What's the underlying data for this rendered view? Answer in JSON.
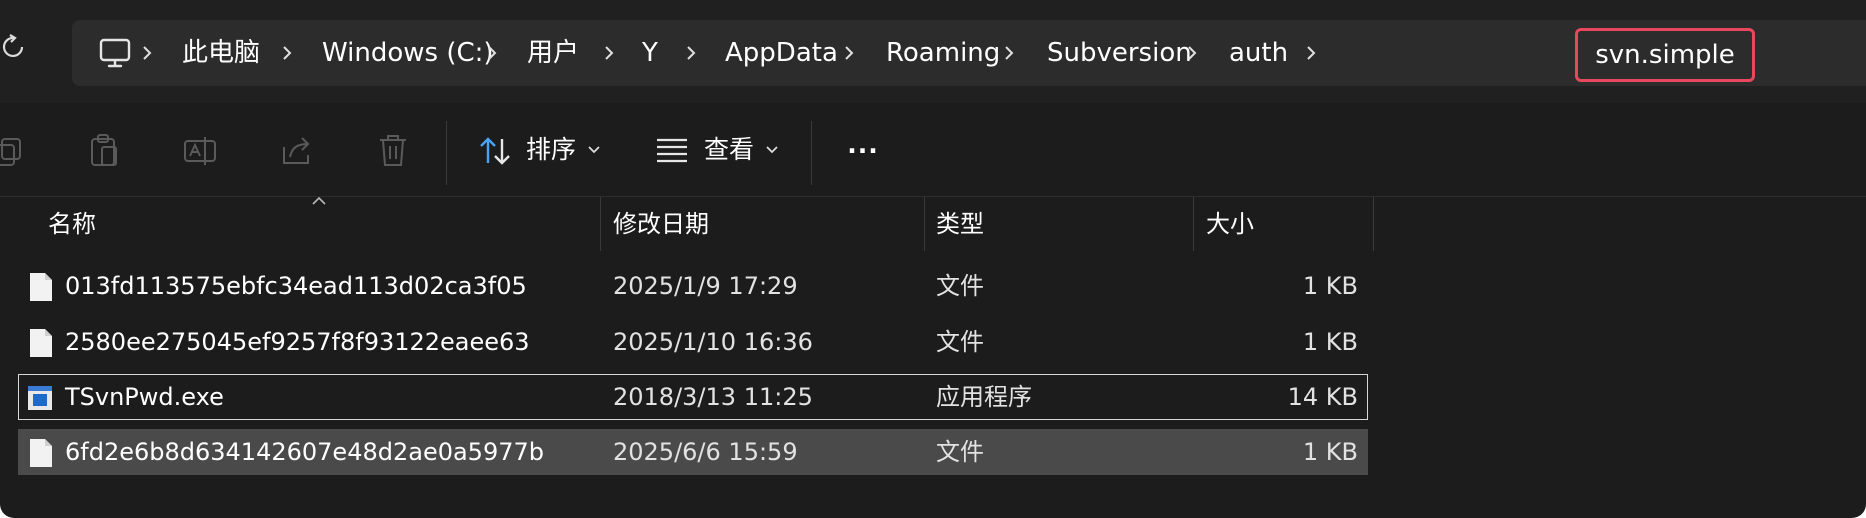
{
  "address_bar": {
    "crumbs": [
      "此电脑",
      "Windows (C:)",
      "用户",
      "Y",
      "AppData",
      "Roaming",
      "Subversion",
      "auth"
    ],
    "current": "svn.simple"
  },
  "toolbar": {
    "sort_label": "排序",
    "view_label": "查看",
    "more_label": "..."
  },
  "columns": {
    "name": "名称",
    "modified": "修改日期",
    "type": "类型",
    "size": "大小"
  },
  "files": [
    {
      "name": "013fd113575ebfc34ead113d02ca3f05",
      "modified": "2025/1/9 17:29",
      "type": "文件",
      "size": "1 KB",
      "icon": "file-icon"
    },
    {
      "name": "2580ee275045ef9257f8f93122eaee63",
      "modified": "2025/1/10 16:36",
      "type": "文件",
      "size": "1 KB",
      "icon": "file-icon"
    },
    {
      "name": "TSvnPwd.exe",
      "modified": "2018/3/13 11:25",
      "type": "应用程序",
      "size": "14 KB",
      "icon": "exe-icon"
    },
    {
      "name": "6fd2e6b8d634142607e48d2ae0a5977b",
      "modified": "2025/6/6 15:59",
      "type": "文件",
      "size": "1 KB",
      "icon": "file-icon"
    }
  ],
  "colors": {
    "background": "#1c1c1c",
    "address_bg": "#2c2c2c",
    "highlight_border": "#e8475e",
    "selected_row": "#4a4a4a"
  }
}
